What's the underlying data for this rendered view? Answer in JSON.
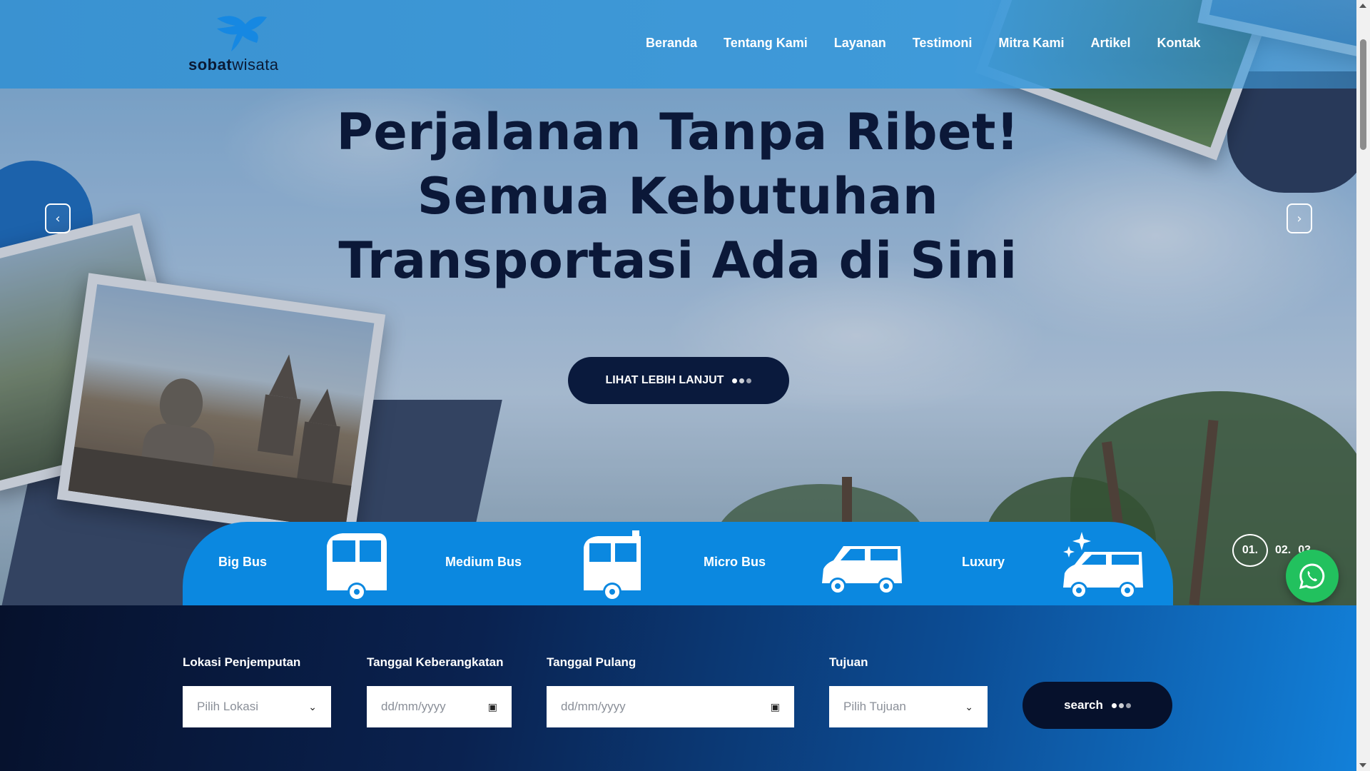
{
  "brand": {
    "name_bold": "sobat",
    "name_light": "wisata",
    "logo_icon": "bird-logo-icon"
  },
  "nav": [
    {
      "label": "Beranda"
    },
    {
      "label": "Tentang Kami"
    },
    {
      "label": "Layanan"
    },
    {
      "label": "Testimoni"
    },
    {
      "label": "Mitra Kami"
    },
    {
      "label": "Artikel"
    },
    {
      "label": "Kontak"
    }
  ],
  "hero": {
    "headline_line1": "Perjalanan Tanpa Ribet!",
    "headline_line2": "Semua Kebutuhan",
    "headline_line3": "Transportasi Ada di Sini",
    "cta_label": "LIHAT LEBIH LANJUT",
    "prev_icon": "chevron-left-icon",
    "next_icon": "chevron-right-icon"
  },
  "categories": [
    {
      "label": "Big Bus",
      "icon": "big-bus-icon"
    },
    {
      "label": "Medium Bus",
      "icon": "medium-bus-icon"
    },
    {
      "label": "Micro Bus",
      "icon": "micro-bus-icon"
    },
    {
      "label": "Luxury",
      "icon": "luxury-van-icon"
    }
  ],
  "slides": {
    "current": "01.",
    "next": "02.",
    "last": "03"
  },
  "search": {
    "pickup_label": "Lokasi Penjemputan",
    "pickup_value": "Pilih Lokasi",
    "depart_label": "Tanggal Keberangkatan",
    "depart_placeholder": "dd/mm/yyyy",
    "return_label": "Tanggal Pulang",
    "return_placeholder": "dd/mm/yyyy",
    "dest_label": "Tujuan",
    "dest_value": "Pilih Tujuan",
    "button_label": "search"
  },
  "colors": {
    "header": "#3f9ad9",
    "dark": "#0a1a3d",
    "bar": "#0b88e0",
    "whatsapp": "#22c15e"
  }
}
